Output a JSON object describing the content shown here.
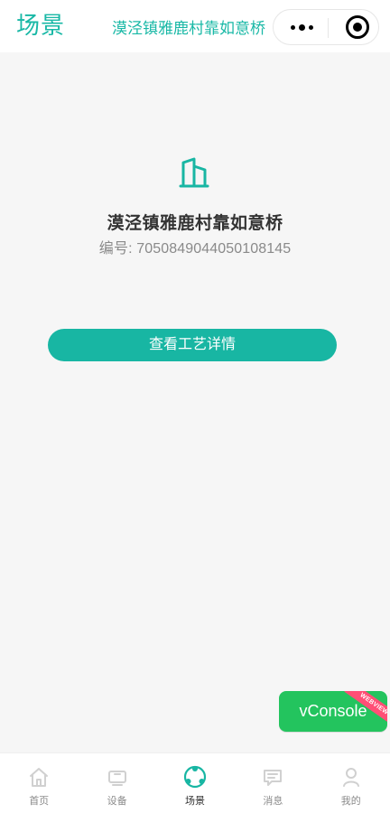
{
  "header": {
    "title": "场景",
    "location_link": "漠泾镇雅鹿村靠如意桥"
  },
  "main": {
    "scene_name": "漠泾镇雅鹿村靠如意桥",
    "id_label": "编号:",
    "id_value": "7050849044050108145",
    "process_button": "查看工艺详情"
  },
  "vconsole": {
    "label": "vConsole",
    "ribbon": "WEBVIEW"
  },
  "tabbar": {
    "items": [
      {
        "label": "首页",
        "icon": "home-icon",
        "active": false
      },
      {
        "label": "设备",
        "icon": "device-icon",
        "active": false
      },
      {
        "label": "场景",
        "icon": "scene-icon",
        "active": true
      },
      {
        "label": "消息",
        "icon": "message-icon",
        "active": false
      },
      {
        "label": "我的",
        "icon": "profile-icon",
        "active": false
      }
    ]
  },
  "colors": {
    "accent": "#18b6a3",
    "vconsole_green": "#23c45e",
    "ribbon_pink": "#ff4f76"
  }
}
